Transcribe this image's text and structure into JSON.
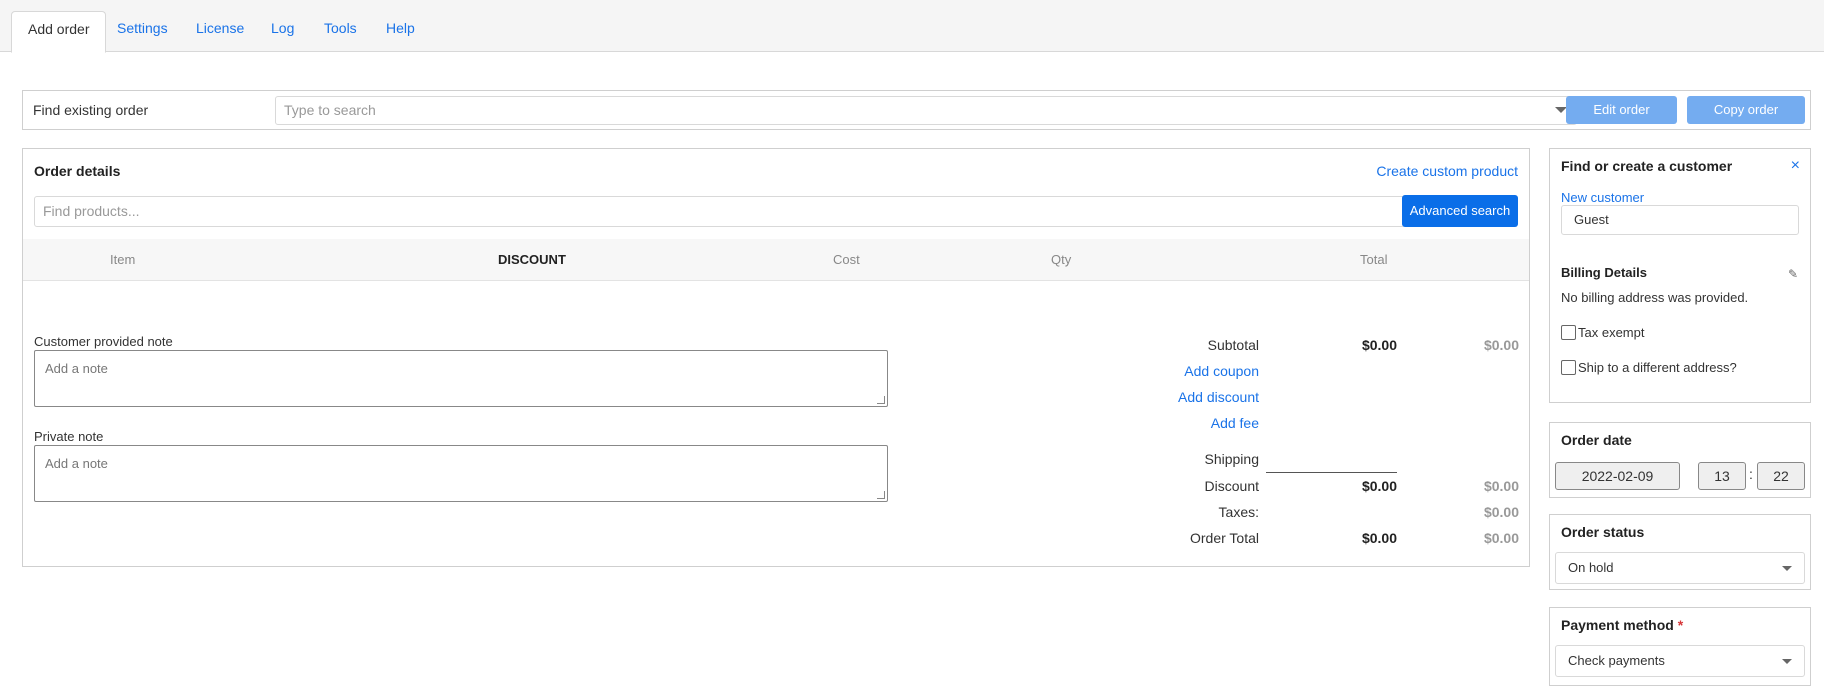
{
  "tabs": [
    {
      "label": "Add order"
    },
    {
      "label": "Settings"
    },
    {
      "label": "License"
    },
    {
      "label": "Log"
    },
    {
      "label": "Tools"
    },
    {
      "label": "Help"
    }
  ],
  "find_order": {
    "label": "Find existing order",
    "placeholder": "Type to search",
    "edit_label": "Edit order",
    "copy_label": "Copy order"
  },
  "order_details": {
    "title": "Order details",
    "create_custom_product": "Create custom product",
    "find_products_placeholder": "Find products...",
    "advanced_search": "Advanced search",
    "columns": [
      "Item",
      "DISCOUNT",
      "Cost",
      "Qty",
      "Total"
    ],
    "customer_note_label": "Customer provided note",
    "customer_note_placeholder": "Add a note",
    "private_note_label": "Private note",
    "private_note_placeholder": "Add a note"
  },
  "totals": {
    "subtotal_label": "Subtotal",
    "subtotal_value": "$0.00",
    "subtotal_value2": "$0.00",
    "add_coupon": "Add coupon",
    "add_discount": "Add discount",
    "add_fee": "Add fee",
    "shipping_label": "Shipping",
    "discount_label": "Discount",
    "discount_value": "$0.00",
    "discount_value2": "$0.00",
    "taxes_label": "Taxes:",
    "taxes_value2": "$0.00",
    "order_total_label": "Order Total",
    "order_total_value": "$0.00",
    "order_total_value2": "$0.00"
  },
  "customer": {
    "title": "Find or create a customer",
    "close_icon": "×",
    "new_customer": "New customer",
    "customer_value": "Guest",
    "billing_title": "Billing Details",
    "billing_text": "No billing address was provided.",
    "tax_exempt": "Tax exempt",
    "ship_different": "Ship to a different address?"
  },
  "order_date": {
    "title": "Order date",
    "date": "2022-02-09",
    "hour": "13",
    "separator": ":",
    "minute": "22"
  },
  "order_status": {
    "title": "Order status",
    "value": "On hold"
  },
  "payment": {
    "title": "Payment method",
    "required_mark": "*",
    "value": "Check payments"
  },
  "colors": {
    "link": "#1a73e8",
    "primary_button": "#0a6ee8",
    "light_button": "#74acf0",
    "required": "#d63638"
  }
}
